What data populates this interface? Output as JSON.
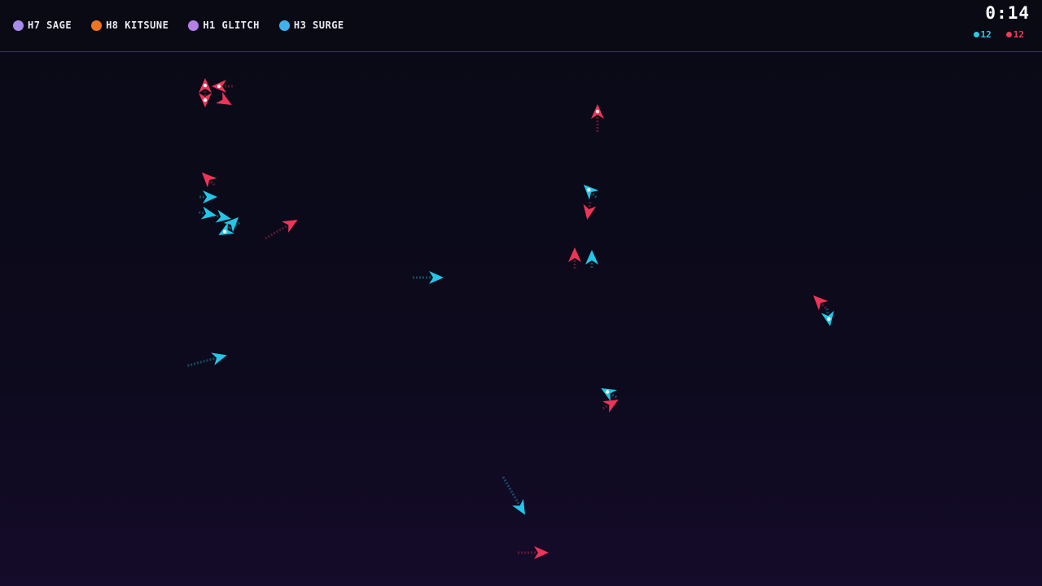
{
  "players": [
    {
      "label": "H7 SAGE",
      "color": "#a98be8"
    },
    {
      "label": "H8 KITSUNE",
      "color": "#f0731f"
    },
    {
      "label": "H1 GLITCH",
      "color": "#b57fe6"
    },
    {
      "label": "H3 SURGE",
      "color": "#3fb2ec"
    }
  ],
  "timer": "0:14",
  "scores": {
    "blue": {
      "value": "12",
      "color": "#2ccbe6"
    },
    "red": {
      "value": "12",
      "color": "#ef3a57"
    }
  },
  "colors": {
    "blue_ship": "#22c6e8",
    "red_ship": "#ee3457"
  }
}
